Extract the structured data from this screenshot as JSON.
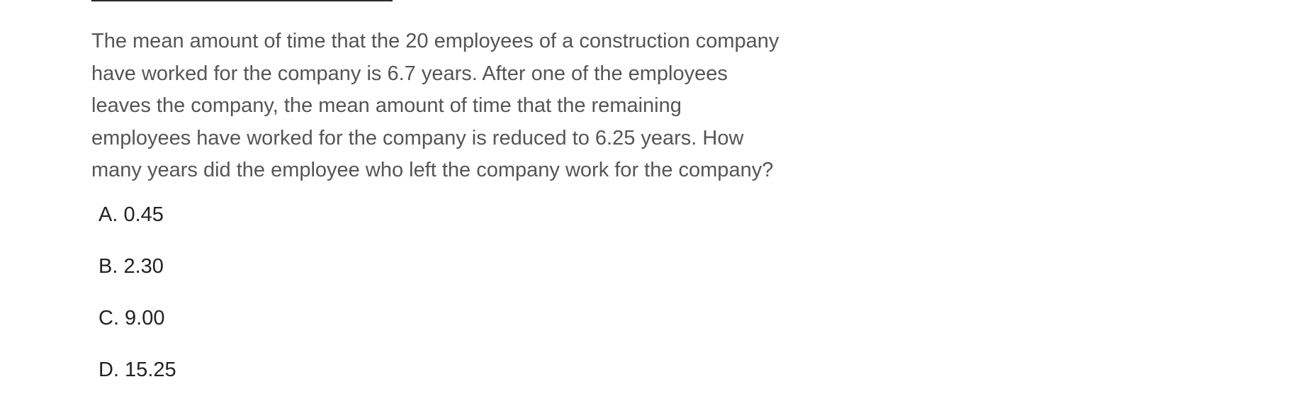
{
  "question": {
    "text": "The mean amount of time that the 20 employees of a construction company\nhave worked for the company is 6.7 years. After one of the employees\nleaves the company, the mean amount of time that the remaining\nemployees have worked for the company is reduced to 6.25 years. How\nmany years did the employee who left the company work for the company?"
  },
  "choices": [
    {
      "label": "A. 0.45"
    },
    {
      "label": "B. 2.30"
    },
    {
      "label": "C. 9.00"
    },
    {
      "label": "D. 15.25"
    }
  ]
}
